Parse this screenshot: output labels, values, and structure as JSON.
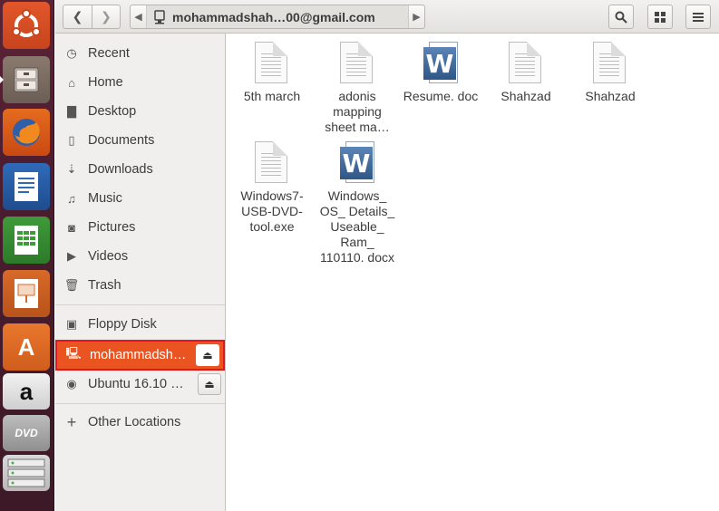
{
  "header": {
    "back_glyph": "❮",
    "forward_glyph": "❯",
    "path_label": "mohammadshah…00@gmail.com",
    "search_glyph": "🔍",
    "view_glyph": "▦",
    "menu_glyph": "☰"
  },
  "sidebar": {
    "places": [
      {
        "label": "Recent",
        "icon": "clock-icon",
        "glyph": "◷"
      },
      {
        "label": "Home",
        "icon": "home-icon",
        "glyph": "⌂"
      },
      {
        "label": "Desktop",
        "icon": "folder-icon",
        "glyph": "▇"
      },
      {
        "label": "Documents",
        "icon": "document-icon",
        "glyph": "▯"
      },
      {
        "label": "Downloads",
        "icon": "download-icon",
        "glyph": "⇣"
      },
      {
        "label": "Music",
        "icon": "music-icon",
        "glyph": "♫"
      },
      {
        "label": "Pictures",
        "icon": "camera-icon",
        "glyph": "◙"
      },
      {
        "label": "Videos",
        "icon": "video-icon",
        "glyph": "▶"
      },
      {
        "label": "Trash",
        "icon": "trash-icon",
        "glyph": "🗑"
      }
    ],
    "devices": [
      {
        "label": "Floppy Disk",
        "icon": "floppy-icon",
        "glyph": "▣"
      },
      {
        "label": "mohammadsh…",
        "icon": "network-drive-icon",
        "glyph": "🖳",
        "eject": "⏏",
        "selected": true
      },
      {
        "label": "Ubuntu 16.10 …",
        "icon": "disc-icon",
        "glyph": "◉",
        "eject": "⏏"
      }
    ],
    "other": {
      "label": "Other Locations",
      "icon": "plus-icon",
      "glyph": "+"
    }
  },
  "files": [
    {
      "name": "5th march",
      "type": "text"
    },
    {
      "name": "adonis mapping sheet ma…",
      "type": "text"
    },
    {
      "name": "Resume. doc",
      "type": "word"
    },
    {
      "name": "Shahzad",
      "type": "text"
    },
    {
      "name": "Shahzad",
      "type": "text"
    },
    {
      "name": "Windows7- USB-DVD- tool.exe",
      "type": "text"
    },
    {
      "name": "Windows_ OS_ Details_ Useable_ Ram_ 110110. docx",
      "type": "word"
    }
  ],
  "launcher": {
    "items": [
      "ubuntu-logo-icon",
      "files-icon",
      "firefox-icon",
      "writer-icon",
      "calc-icon",
      "impress-icon",
      "software-center-icon",
      "amazon-icon",
      "dvd-icon",
      "server-icon"
    ],
    "amazon_glyph": "a",
    "store_glyph": "A",
    "dvd_label": "DVD"
  },
  "colors": {
    "accent": "#E95420",
    "highlight_border": "#E2171B",
    "launcher": "#4A1D2E"
  }
}
